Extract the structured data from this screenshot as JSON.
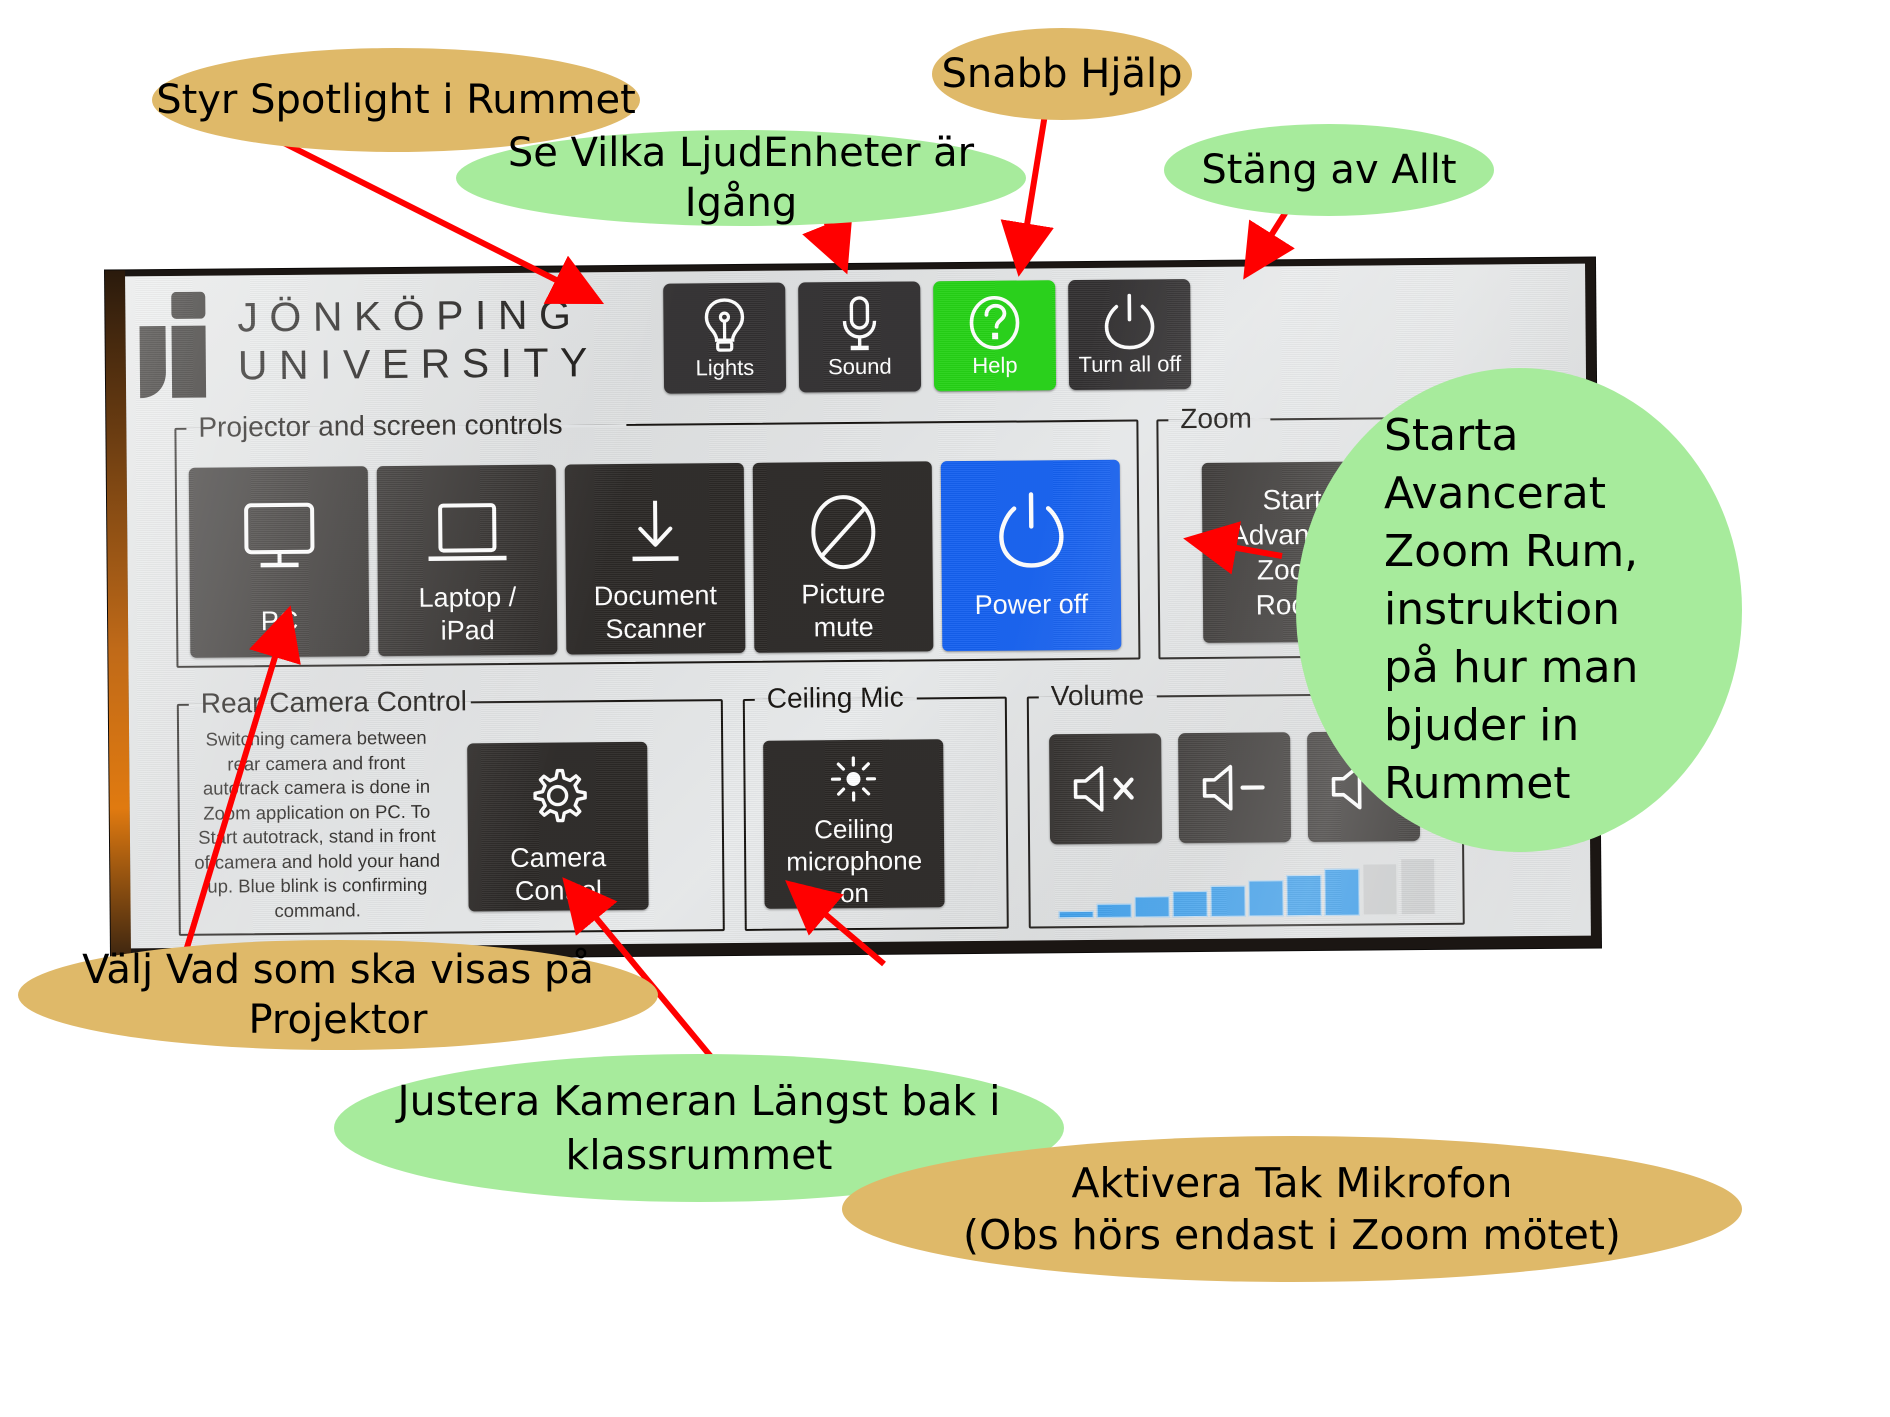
{
  "panel": {
    "logo": {
      "line1": "JÖNKÖPING",
      "line2": "UNIVERSITY",
      "icon": "ju-logo-icon"
    },
    "top_buttons": [
      {
        "label": "Lights",
        "icon": "lightbulb-icon",
        "color": "#323031",
        "active": false
      },
      {
        "label": "Sound",
        "icon": "microphone-icon",
        "color": "#323031",
        "active": false
      },
      {
        "label": "Help",
        "icon": "question-circle-icon",
        "color": "#25d216",
        "active": true
      },
      {
        "label": "Turn all off",
        "icon": "power-icon",
        "color": "#323031",
        "active": false
      }
    ],
    "groups": {
      "projector": {
        "title": "Projector and screen controls",
        "buttons": [
          {
            "label": "PC",
            "icon": "monitor-icon",
            "color": "#2b2826"
          },
          {
            "label": "Laptop /\niPad",
            "icon": "laptop-icon",
            "color": "#2b2826"
          },
          {
            "label": "Document\nScanner",
            "icon": "download-arrow-icon",
            "color": "#2b2826"
          },
          {
            "label": "Picture\nmute",
            "icon": "no-entry-icon",
            "color": "#2b2826"
          },
          {
            "label": "Power off",
            "icon": "power-icon",
            "color": "#1560ef"
          }
        ],
        "labels": {
          "pc": "PC",
          "laptop_l1": "Laptop /",
          "laptop_l2": "iPad",
          "doc_l1": "Document",
          "doc_l2": "Scanner",
          "pic_l1": "Picture",
          "pic_l2": "mute",
          "power": "Power off"
        }
      },
      "zoom": {
        "title": "Zoom",
        "button": {
          "l1": "Start",
          "l2": "Advanced",
          "l3": "Zoom",
          "l4": "Room",
          "color": "#2b2826"
        }
      },
      "rear_camera": {
        "title": "Rear Camera Control",
        "description": "Switching camera between rear camera and front autotrack camera is done in Zoom application on PC. To Start autotrack, stand in front of camera and hold your hand up. Blue blink is confirming command.",
        "button": {
          "l1": "Camera",
          "l2": "Control",
          "icon": "gear-icon",
          "color": "#2b2826"
        }
      },
      "ceiling_mic": {
        "title": "Ceiling Mic",
        "button": {
          "l1": "Ceiling",
          "l2": "microphone",
          "l3": "on",
          "icon": "sun-brightness-icon",
          "color": "#2b2826"
        }
      },
      "volume": {
        "title": "Volume",
        "buttons": [
          {
            "icon": "speaker-mute-icon",
            "label": "×"
          },
          {
            "icon": "speaker-down-icon",
            "label": "−"
          },
          {
            "icon": "speaker-up-icon",
            "label": "+"
          }
        ],
        "meter": {
          "total_bars": 10,
          "filled_bars": 8,
          "fill_color": "#2f97e8",
          "empty_color": "#c9cbcc"
        }
      }
    }
  },
  "annotations": [
    {
      "id": "b-spot",
      "text": "Styr Spotlight i Rummet",
      "color": "#dfb969"
    },
    {
      "id": "b-ljud",
      "text": "Se Vilka LjudEnheter är Igång",
      "color": "#a7eb9c"
    },
    {
      "id": "b-snabb",
      "text": "Snabb Hjälp",
      "color": "#dfb969"
    },
    {
      "id": "b-stang",
      "text": "Stäng av Allt",
      "color": "#a7eb9c"
    },
    {
      "id": "b-starta",
      "text": "Starta Avancerat Zoom Rum, instruktion på hur man bjuder in Rummet",
      "color": "#a7eb9c"
    },
    {
      "id": "b-valj",
      "text": "Välj Vad som ska visas på Projektor",
      "color": "#dfb969"
    },
    {
      "id": "b-justera",
      "text": "Justera Kameran Längst bak i klassrummet",
      "color": "#a7eb9c"
    },
    {
      "id": "b-aktivera",
      "text": "Aktivera Tak Mikrofon\n(Obs hörs endast i Zoom mötet)",
      "color": "#dfb969"
    }
  ],
  "annotation_text": {
    "spotlight": "Styr Spotlight i Rummet",
    "ljud": "Se Vilka LjudEnheter är Igång",
    "snabb": "Snabb Hjälp",
    "stang": "Stäng av Allt",
    "starta_l1": "Starta",
    "starta_l2": "Avancerat",
    "starta_l3": "Zoom Rum,",
    "starta_l4": "instruktion",
    "starta_l5": "på hur man",
    "starta_l6": "bjuder in",
    "starta_l7": "Rummet",
    "valj": "Välj Vad som ska visas på Projektor",
    "justera_l1": "Justera Kameran Längst bak i",
    "justera_l2": "klassrummet",
    "aktivera_l1": "Aktivera Tak Mikrofon",
    "aktivera_l2": "(Obs hörs endast i Zoom mötet)"
  },
  "colors": {
    "arrow": "#ff0000",
    "tan_bubble": "#dfb969",
    "green_bubble": "#a7eb9c",
    "help_green": "#25d216",
    "power_blue": "#1560ef"
  }
}
